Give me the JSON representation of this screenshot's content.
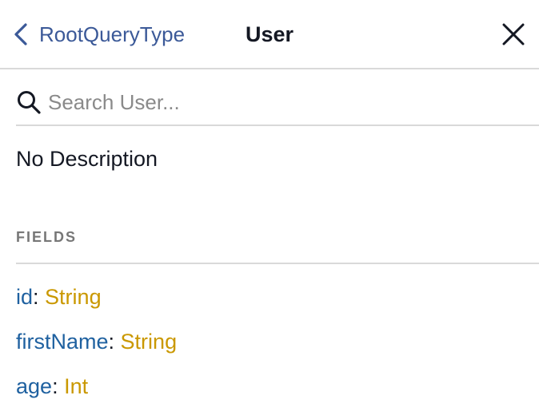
{
  "header": {
    "back_label": "RootQueryType",
    "title": "User",
    "close_icon": "close-icon",
    "back_icon": "chevron-left-icon"
  },
  "search": {
    "placeholder": "Search User...",
    "value": "",
    "icon": "search-icon"
  },
  "description": "No Description",
  "fields_section": {
    "title": "FIELDS",
    "colon": ":",
    "items": [
      {
        "name": "id",
        "type": "String"
      },
      {
        "name": "firstName",
        "type": "String"
      },
      {
        "name": "age",
        "type": "Int"
      }
    ]
  },
  "colors": {
    "link": "#3b5998",
    "field_name": "#1f61a0",
    "field_type": "#ca9800",
    "divider": "#d9d9d9",
    "section_title": "#777777"
  }
}
